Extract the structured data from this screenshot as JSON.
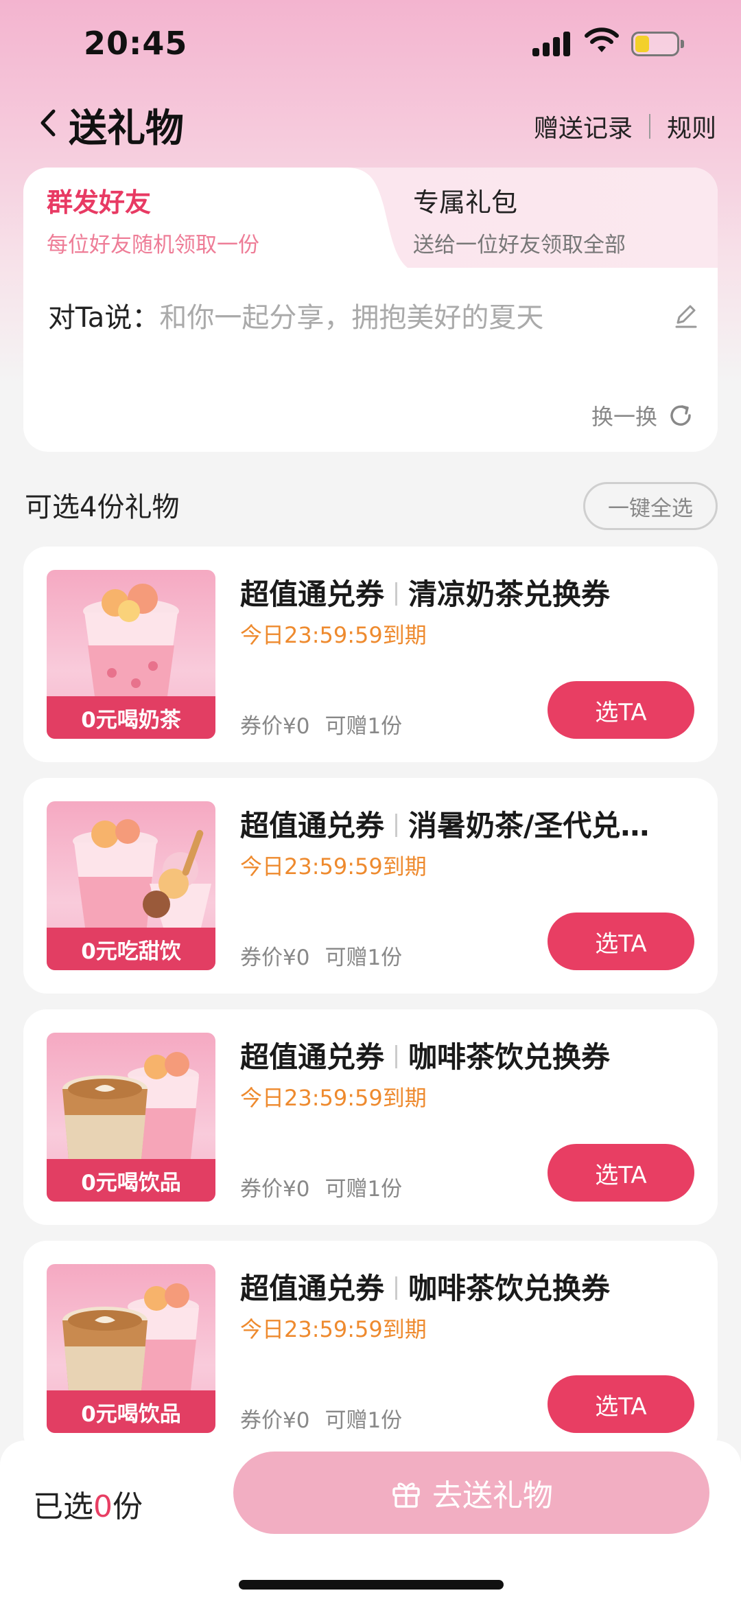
{
  "status_bar": {
    "time": "20:45"
  },
  "nav": {
    "title": "送礼物",
    "record_label": "赠送记录",
    "rules_label": "规则"
  },
  "tabs": [
    {
      "title": "群发好友",
      "subtitle": "每位好友随机领取一份"
    },
    {
      "title": "专属礼包",
      "subtitle": "送给一位好友领取全部"
    }
  ],
  "message": {
    "label": "对Ta说：",
    "text": "和你一起分享，拥抱美好的夏天",
    "refresh_label": "换一换"
  },
  "section": {
    "title": "可选4份礼物",
    "select_all_label": "一键全选"
  },
  "gifts": [
    {
      "tag": "0元喝奶茶",
      "category": "超值通兑券",
      "name": "清凉奶茶兑换券",
      "expire": "今日23:59:59到期",
      "price": "券价¥0",
      "quantity": "可赠1份",
      "button": "选TA"
    },
    {
      "tag": "0元吃甜饮",
      "category": "超值通兑券",
      "name": "消暑奶茶/圣代兑…",
      "expire": "今日23:59:59到期",
      "price": "券价¥0",
      "quantity": "可赠1份",
      "button": "选TA"
    },
    {
      "tag": "0元喝饮品",
      "category": "超值通兑券",
      "name": "咖啡茶饮兑换券",
      "expire": "今日23:59:59到期",
      "price": "券价¥0",
      "quantity": "可赠1份",
      "button": "选TA"
    },
    {
      "tag": "0元喝饮品",
      "category": "超值通兑券",
      "name": "咖啡茶饮兑换券",
      "expire": "今日23:59:59到期",
      "price": "券价¥0",
      "quantity": "可赠1份",
      "button": "选TA"
    }
  ],
  "bottom": {
    "selected_prefix": "已选",
    "selected_count": "0",
    "selected_suffix": "份",
    "send_label": "去送礼物"
  },
  "colors": {
    "accent": "#e83e63",
    "expire": "#ee8a2e",
    "send_disabled": "#f2aec2"
  }
}
